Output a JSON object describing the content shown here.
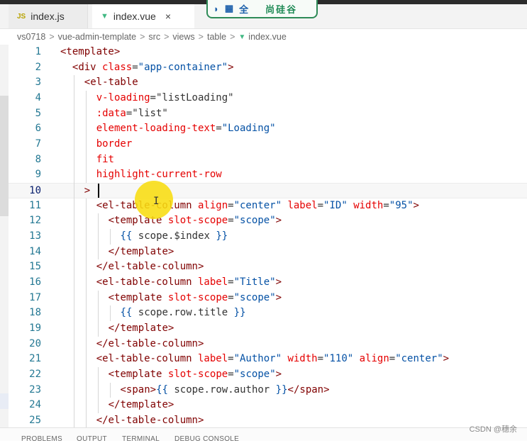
{
  "colors": {
    "tag": "#800000",
    "attr": "#e50000",
    "string": "#0451a5",
    "expr": "#333333",
    "punct": "#800000",
    "line_number": "#237893",
    "vue_icon": "#41b883"
  },
  "tabs": [
    {
      "icon": "JS",
      "label": "index.js"
    },
    {
      "icon": "vue-icon",
      "label": "index.vue",
      "close": "×"
    }
  ],
  "ime_bar": {
    "moon": "◗",
    "keyboard": "▦",
    "mode": "全",
    "brand": "尚硅谷"
  },
  "breadcrumb": [
    "vs0718",
    "vue-admin-template",
    "src",
    "views",
    "table",
    "index.vue"
  ],
  "breadcrumb_sep": ">",
  "code_lines": [
    {
      "n": "1",
      "indent": 0,
      "tokens": [
        {
          "t": "<template>",
          "k": "tag"
        }
      ]
    },
    {
      "n": "2",
      "indent": 2,
      "tokens": [
        {
          "t": "<div ",
          "k": "tag"
        },
        {
          "t": "class",
          "k": "attr"
        },
        {
          "t": "=",
          "k": "expr"
        },
        {
          "t": "\"app-container\"",
          "k": "string"
        },
        {
          "t": ">",
          "k": "tag"
        }
      ]
    },
    {
      "n": "3",
      "indent": 4,
      "tokens": [
        {
          "t": "<el-table",
          "k": "tag"
        }
      ]
    },
    {
      "n": "4",
      "indent": 6,
      "tokens": [
        {
          "t": "v-loading",
          "k": "attr"
        },
        {
          "t": "=\"listLoading\"",
          "k": "expr"
        }
      ]
    },
    {
      "n": "5",
      "indent": 6,
      "tokens": [
        {
          "t": ":data",
          "k": "attr"
        },
        {
          "t": "=\"list\"",
          "k": "expr"
        }
      ]
    },
    {
      "n": "6",
      "indent": 6,
      "tokens": [
        {
          "t": "element-loading-text",
          "k": "attr"
        },
        {
          "t": "=",
          "k": "expr"
        },
        {
          "t": "\"Loading\"",
          "k": "string"
        }
      ]
    },
    {
      "n": "7",
      "indent": 6,
      "tokens": [
        {
          "t": "border",
          "k": "attr"
        }
      ]
    },
    {
      "n": "8",
      "indent": 6,
      "tokens": [
        {
          "t": "fit",
          "k": "attr"
        }
      ]
    },
    {
      "n": "9",
      "indent": 6,
      "tokens": [
        {
          "t": "highlight-current-row",
          "k": "attr"
        }
      ]
    },
    {
      "n": "10",
      "indent": 4,
      "tokens": [
        {
          "t": ">",
          "k": "tag"
        }
      ]
    },
    {
      "n": "11",
      "indent": 6,
      "tokens": [
        {
          "t": "<el-table-column ",
          "k": "tag"
        },
        {
          "t": "align",
          "k": "attr"
        },
        {
          "t": "=",
          "k": "expr"
        },
        {
          "t": "\"center\" ",
          "k": "string"
        },
        {
          "t": "label",
          "k": "attr"
        },
        {
          "t": "=",
          "k": "expr"
        },
        {
          "t": "\"ID\" ",
          "k": "string"
        },
        {
          "t": "width",
          "k": "attr"
        },
        {
          "t": "=",
          "k": "expr"
        },
        {
          "t": "\"95\"",
          "k": "string"
        },
        {
          "t": ">",
          "k": "tag"
        }
      ]
    },
    {
      "n": "12",
      "indent": 8,
      "tokens": [
        {
          "t": "<template ",
          "k": "tag"
        },
        {
          "t": "slot-scope",
          "k": "attr"
        },
        {
          "t": "=",
          "k": "expr"
        },
        {
          "t": "\"scope\"",
          "k": "string"
        },
        {
          "t": ">",
          "k": "tag"
        }
      ]
    },
    {
      "n": "13",
      "indent": 10,
      "tokens": [
        {
          "t": "{{ ",
          "k": "string"
        },
        {
          "t": "scope.$index",
          "k": "expr"
        },
        {
          "t": " }}",
          "k": "string"
        }
      ]
    },
    {
      "n": "14",
      "indent": 8,
      "tokens": [
        {
          "t": "</template>",
          "k": "tag"
        }
      ]
    },
    {
      "n": "15",
      "indent": 6,
      "tokens": [
        {
          "t": "</el-table-column>",
          "k": "tag"
        }
      ]
    },
    {
      "n": "16",
      "indent": 6,
      "tokens": [
        {
          "t": "<el-table-column ",
          "k": "tag"
        },
        {
          "t": "label",
          "k": "attr"
        },
        {
          "t": "=",
          "k": "expr"
        },
        {
          "t": "\"Title\"",
          "k": "string"
        },
        {
          "t": ">",
          "k": "tag"
        }
      ]
    },
    {
      "n": "17",
      "indent": 8,
      "tokens": [
        {
          "t": "<template ",
          "k": "tag"
        },
        {
          "t": "slot-scope",
          "k": "attr"
        },
        {
          "t": "=",
          "k": "expr"
        },
        {
          "t": "\"scope\"",
          "k": "string"
        },
        {
          "t": ">",
          "k": "tag"
        }
      ]
    },
    {
      "n": "18",
      "indent": 10,
      "tokens": [
        {
          "t": "{{ ",
          "k": "string"
        },
        {
          "t": "scope.row.title",
          "k": "expr"
        },
        {
          "t": " }}",
          "k": "string"
        }
      ]
    },
    {
      "n": "19",
      "indent": 8,
      "tokens": [
        {
          "t": "</template>",
          "k": "tag"
        }
      ]
    },
    {
      "n": "20",
      "indent": 6,
      "tokens": [
        {
          "t": "</el-table-column>",
          "k": "tag"
        }
      ]
    },
    {
      "n": "21",
      "indent": 6,
      "tokens": [
        {
          "t": "<el-table-column ",
          "k": "tag"
        },
        {
          "t": "label",
          "k": "attr"
        },
        {
          "t": "=",
          "k": "expr"
        },
        {
          "t": "\"Author\" ",
          "k": "string"
        },
        {
          "t": "width",
          "k": "attr"
        },
        {
          "t": "=",
          "k": "expr"
        },
        {
          "t": "\"110\" ",
          "k": "string"
        },
        {
          "t": "align",
          "k": "attr"
        },
        {
          "t": "=",
          "k": "expr"
        },
        {
          "t": "\"center\"",
          "k": "string"
        },
        {
          "t": ">",
          "k": "tag"
        }
      ]
    },
    {
      "n": "22",
      "indent": 8,
      "tokens": [
        {
          "t": "<template ",
          "k": "tag"
        },
        {
          "t": "slot-scope",
          "k": "attr"
        },
        {
          "t": "=",
          "k": "expr"
        },
        {
          "t": "\"scope\"",
          "k": "string"
        },
        {
          "t": ">",
          "k": "tag"
        }
      ]
    },
    {
      "n": "23",
      "indent": 10,
      "tokens": [
        {
          "t": "<span>",
          "k": "tag"
        },
        {
          "t": "{{ ",
          "k": "string"
        },
        {
          "t": "scope.row.author",
          "k": "expr"
        },
        {
          "t": " }}",
          "k": "string"
        },
        {
          "t": "</span>",
          "k": "tag"
        }
      ]
    },
    {
      "n": "24",
      "indent": 8,
      "tokens": [
        {
          "t": "</template>",
          "k": "tag"
        }
      ]
    },
    {
      "n": "25",
      "indent": 6,
      "tokens": [
        {
          "t": "</el-table-column>",
          "k": "tag"
        }
      ]
    }
  ],
  "current_line": "10",
  "panel_tabs": [
    "PROBLEMS",
    "OUTPUT",
    "TERMINAL",
    "DEBUG CONSOLE"
  ],
  "watermark": "CSDN @穗余"
}
